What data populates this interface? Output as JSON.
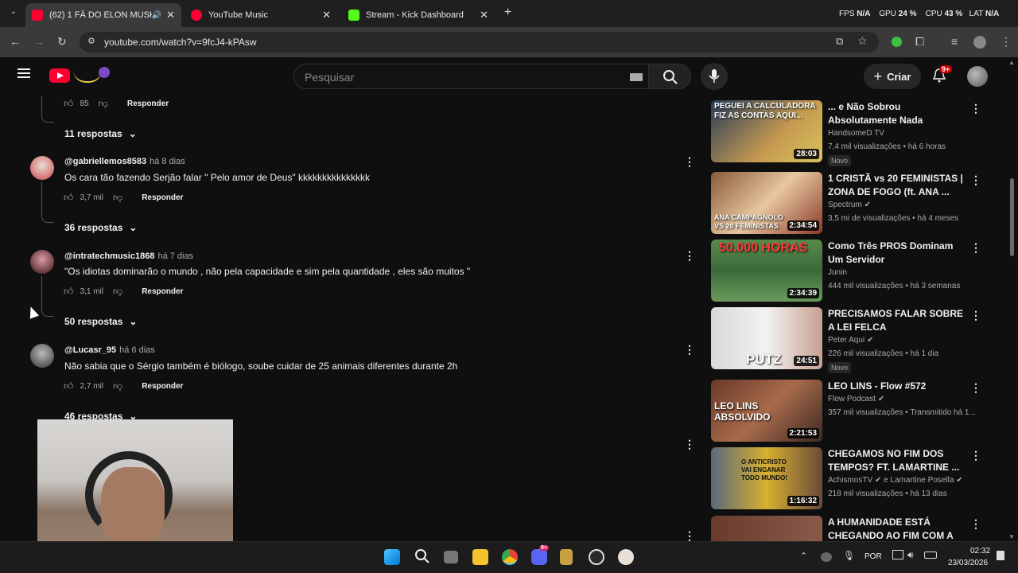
{
  "browser": {
    "tabs": [
      {
        "title": "(62) 1 FÃ DO ELON MUSK X",
        "active": true
      },
      {
        "title": "YouTube Music",
        "active": false
      },
      {
        "title": "Stream - Kick Dashboard",
        "active": false
      }
    ],
    "new_tab": "+",
    "url": "youtube.com/watch?v=9fcJ4-kPAsw",
    "overlay": {
      "fps_label": "FPS",
      "fps_value": "N/A",
      "gpu_label": "GPU",
      "gpu_value": "24 %",
      "cpu_label": "CPU",
      "cpu_value": "43 %",
      "lat_label": "LAT",
      "lat_value": "N/A"
    }
  },
  "header": {
    "search_placeholder": "Pesquisar",
    "create_label": "Criar",
    "notif_badge": "9+"
  },
  "comments": {
    "top": {
      "likes": "85",
      "reply": "Responder",
      "replies": "11 respostas"
    },
    "items": [
      {
        "user": "@gabriellemos8583",
        "time": "há 8 dias",
        "text": "Os cara tão fazendo Serjão falar \" Pelo amor de Deus\" kkkkkkkkkkkkkkk",
        "likes": "3,7 mil",
        "reply": "Responder",
        "replies": "36 respostas"
      },
      {
        "user": "@intratechmusic1868",
        "time": "há 7 dias",
        "text": "\"Os idiotas dominarão o mundo , não pela capacidade e sim pela quantidade , eles são muitos \"",
        "likes": "3,1 mil",
        "reply": "Responder",
        "replies": "50 respostas"
      },
      {
        "user": "@Lucasr_95",
        "time": "há 6 dias",
        "text": "Não sabia que o Sérgio também é biólogo, soube cuidar de 25 animais diferentes durante 2h",
        "likes": "2,7 mil",
        "reply": "Responder",
        "replies": "46 respostas"
      }
    ]
  },
  "sidebar": {
    "items": [
      {
        "title": "... e Não Sobrou Absolutamente Nada",
        "channel": "HandsomeD TV",
        "meta": "7,4 mil visualizações • há 6 horas",
        "badge": "Novo",
        "duration": "28:03",
        "thumb_text": "PEGUEI A CALCULADORA FIZ AS CONTAS AQUI...",
        "verified": false
      },
      {
        "title": "1 CRISTÃ vs 20 FEMINISTAS | ZONA DE FOGO (ft. ANA ...",
        "channel": "Spectrum",
        "meta": "3,5 mi de visualizações • há 4 meses",
        "badge": "",
        "duration": "2:34:54",
        "thumb_text": "ANA CAMPAGNOLO VS 20 FEMINISTAS",
        "verified": true
      },
      {
        "title": "Como Três PROS Dominam Um Servidor",
        "channel": "Junin",
        "meta": "444 mil visualizações • há 3 semanas",
        "badge": "",
        "duration": "2:34:39",
        "thumb_text": "50.000 HORAS",
        "verified": false
      },
      {
        "title": "PRECISAMOS FALAR SOBRE A LEI FELCA",
        "channel": "Peter Aqui",
        "meta": "226 mil visualizações • há 1 dia",
        "badge": "Novo",
        "duration": "24:51",
        "thumb_text": "PUTZ",
        "verified": true
      },
      {
        "title": "LEO LINS - Flow #572",
        "channel": "Flow Podcast",
        "meta": "357 mil visualizações • Transmitido há 1...",
        "badge": "",
        "duration": "2:21:53",
        "thumb_text": "LEO LINS ABSOLVIDO",
        "verified": true
      },
      {
        "title": "CHEGAMOS NO FIM DOS TEMPOS? FT. LAMARTINE ...",
        "channel": "AchismosTV",
        "channel2": "e Lamartine Posella",
        "meta": "218 mil visualizações • há 13 dias",
        "badge": "",
        "duration": "1:16:32",
        "thumb_text": "O ANTICRISTO VAI ENGANAR TODO MUNDO!",
        "verified": true
      },
      {
        "title": "A HUMANIDADE ESTÁ CHEGANDO AO FIM COM A IA...",
        "channel": "",
        "meta": "",
        "badge": "",
        "duration": "",
        "thumb_text": "",
        "verified": false
      }
    ]
  },
  "taskbar": {
    "lang": "POR",
    "time": "02:32",
    "date": "23/03/2026",
    "discord_badge": "9+"
  },
  "colors": {
    "accent_red": "#ff0033",
    "bg": "#0f0f0f",
    "kick_green": "#53fc18"
  }
}
